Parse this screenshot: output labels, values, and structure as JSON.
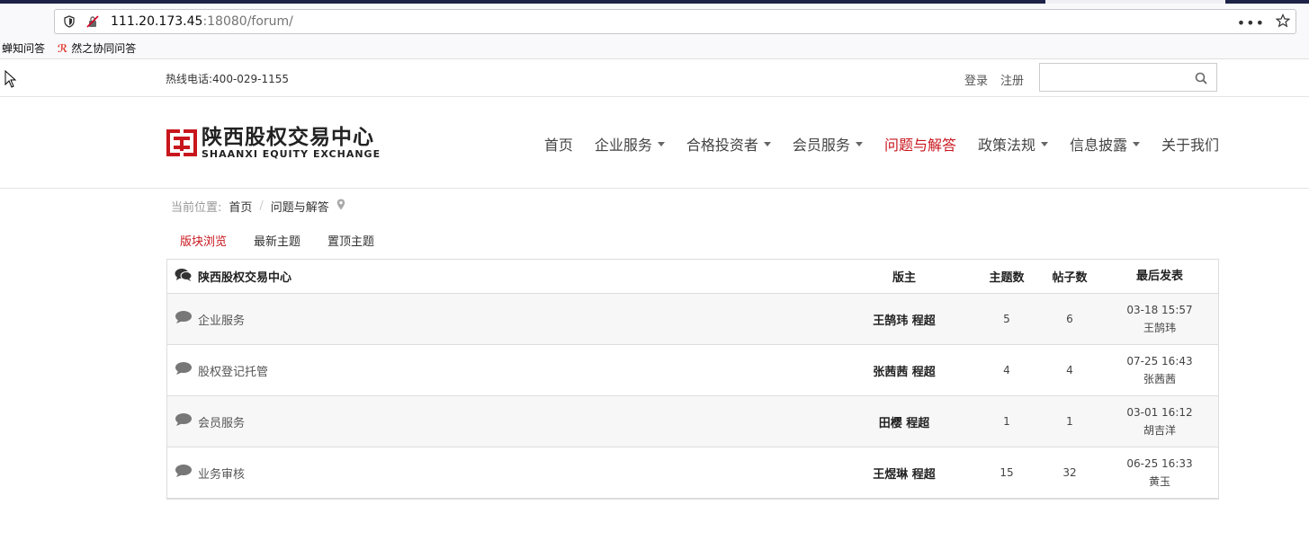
{
  "browser": {
    "url_host": "111.20.173.45",
    "url_rest": ":18080/forum/",
    "bookmarks": [
      "蝉知问答",
      "然之协同问答"
    ]
  },
  "topbar": {
    "hotline": "热线电话:400-029-1155",
    "login": "登录",
    "register": "注册",
    "search_value": ""
  },
  "logo": {
    "cn": "陕西股权交易中心",
    "en": "SHAANXI EQUITY EXCHANGE",
    "color": "#c8161d"
  },
  "nav": [
    {
      "label": "首页",
      "dropdown": false,
      "active": false
    },
    {
      "label": "企业服务",
      "dropdown": true,
      "active": false
    },
    {
      "label": "合格投资者",
      "dropdown": true,
      "active": false
    },
    {
      "label": "会员服务",
      "dropdown": true,
      "active": false
    },
    {
      "label": "问题与解答",
      "dropdown": false,
      "active": true
    },
    {
      "label": "政策法规",
      "dropdown": true,
      "active": false
    },
    {
      "label": "信息披露",
      "dropdown": true,
      "active": false
    },
    {
      "label": "关于我们",
      "dropdown": false,
      "active": false
    }
  ],
  "breadcrumb": {
    "prefix": "当前位置:",
    "items": [
      "首页",
      "问题与解答"
    ],
    "separator": "/"
  },
  "tabs": [
    {
      "label": "版块浏览",
      "active": true
    },
    {
      "label": "最新主题",
      "active": false
    },
    {
      "label": "置顶主题",
      "active": false
    }
  ],
  "forum": {
    "headers": {
      "name": "陕西股权交易中心",
      "moderator": "版主",
      "topics": "主题数",
      "posts": "帖子数",
      "last": "最后发表"
    },
    "rows": [
      {
        "name": "企业服务",
        "moderator": "王鹄玮 程超",
        "topics": "5",
        "posts": "6",
        "last_time": "03-18 15:57",
        "last_user": "王鹄玮"
      },
      {
        "name": "股权登记托管",
        "moderator": "张茜茜 程超",
        "topics": "4",
        "posts": "4",
        "last_time": "07-25 16:43",
        "last_user": "张茜茜"
      },
      {
        "name": "会员服务",
        "moderator": "田樱 程超",
        "topics": "1",
        "posts": "1",
        "last_time": "03-01 16:12",
        "last_user": "胡吉洋"
      },
      {
        "name": "业务审核",
        "moderator": "王煜琳 程超",
        "topics": "15",
        "posts": "32",
        "last_time": "06-25 16:33",
        "last_user": "黄玉"
      }
    ]
  }
}
